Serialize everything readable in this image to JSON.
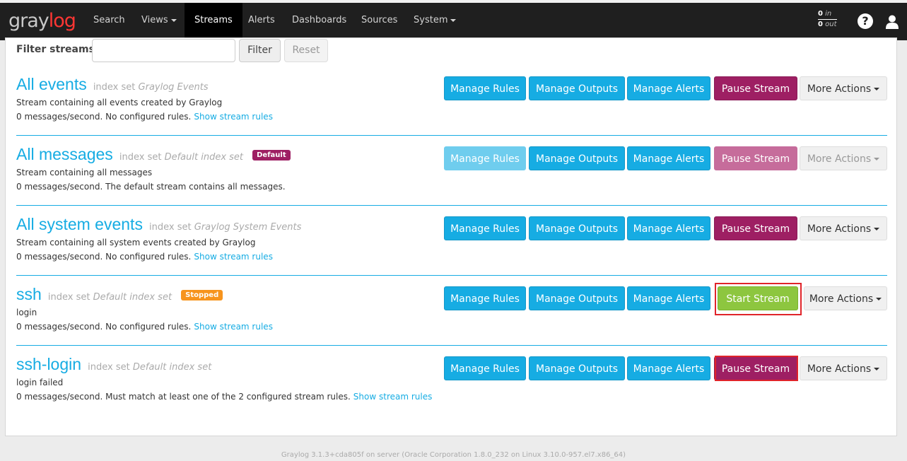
{
  "brand": {
    "part1": "gray",
    "part2": "log"
  },
  "nav": {
    "search": "Search",
    "views": "Views",
    "streams": "Streams",
    "alerts": "Alerts",
    "dashboards": "Dashboards",
    "sources": "Sources",
    "system": "System"
  },
  "throughput": {
    "in_count": "0",
    "in_label": "in",
    "out_count": "0",
    "out_label": "out"
  },
  "filter": {
    "label": "Filter streams",
    "input_value": "",
    "filter_button": "Filter",
    "reset_button": "Reset"
  },
  "streams": [
    {
      "title": "All events",
      "index_prefix": "index set",
      "index_name": "Graylog Events",
      "badge": "",
      "description": "Stream containing all events created by Graylog",
      "info": "0 messages/second. No configured rules.",
      "link": "Show stream rules",
      "manage_rules": "Manage Rules",
      "manage_outputs": "Manage Outputs",
      "manage_alerts": "Manage Alerts",
      "toggle": "Pause Stream",
      "more": "More Actions"
    },
    {
      "title": "All messages",
      "index_prefix": "index set",
      "index_name": "Default index set",
      "badge": "Default",
      "description": "Stream containing all messages",
      "info": "0 messages/second. The default stream contains all messages.",
      "link": "",
      "manage_rules": "Manage Rules",
      "manage_outputs": "Manage Outputs",
      "manage_alerts": "Manage Alerts",
      "toggle": "Pause Stream",
      "more": "More Actions"
    },
    {
      "title": "All system events",
      "index_prefix": "index set",
      "index_name": "Graylog System Events",
      "badge": "",
      "description": "Stream containing all system events created by Graylog",
      "info": "0 messages/second. No configured rules.",
      "link": "Show stream rules",
      "manage_rules": "Manage Rules",
      "manage_outputs": "Manage Outputs",
      "manage_alerts": "Manage Alerts",
      "toggle": "Pause Stream",
      "more": "More Actions"
    },
    {
      "title": "ssh",
      "index_prefix": "index set",
      "index_name": "Default index set",
      "badge": "Stopped",
      "description": "login",
      "info": "0 messages/second. No configured rules.",
      "link": "Show stream rules",
      "manage_rules": "Manage Rules",
      "manage_outputs": "Manage Outputs",
      "manage_alerts": "Manage Alerts",
      "toggle": "Start Stream",
      "more": "More Actions"
    },
    {
      "title": "ssh-login",
      "index_prefix": "index set",
      "index_name": "Default index set",
      "badge": "",
      "description": "login failed",
      "info": "0 messages/second. Must match at least one of the 2 configured stream rules.",
      "link": "Show stream rules",
      "manage_rules": "Manage Rules",
      "manage_outputs": "Manage Outputs",
      "manage_alerts": "Manage Alerts",
      "toggle": "Pause Stream",
      "more": "More Actions"
    }
  ],
  "colors": {
    "accent": "#16ace3",
    "pause": "#9e1f63",
    "start": "#8dc63f",
    "default_badge": "#9e1f63",
    "stopped_badge": "#f7941d",
    "highlight": "#e0242a"
  },
  "footer": "Graylog 3.1.3+cda805f on server (Oracle Corporation 1.8.0_232 on Linux 3.10.0-957.el7.x86_64)"
}
